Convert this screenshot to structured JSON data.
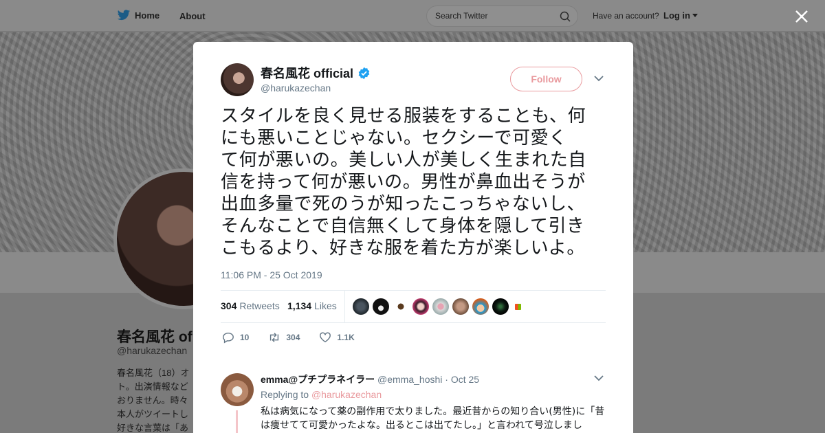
{
  "nav": {
    "home_label": "Home",
    "about_label": "About",
    "search_placeholder": "Search Twitter",
    "account_prompt": "Have an account?",
    "login_label": "Log in"
  },
  "profile": {
    "name": "春名風花 of",
    "handle": "@harukazechan",
    "bio_lines": [
      "春名風花（18）オ",
      "ト。出演情報など",
      "おりません。時々",
      "本人がツイートし",
      "好きな言葉は「あ"
    ]
  },
  "tweet": {
    "author_name": "春名風花 official",
    "author_handle": "@harukazechan",
    "verified": true,
    "follow_label": "Follow",
    "text_lines": [
      "スタイルを良く見せる服装をすることも、何",
      "にも悪いことじゃない。セクシーで可愛く",
      "て何が悪いの。美しい人が美しく生まれた自",
      "信を持って何が悪いの。男性が鼻血出そうが",
      "出血多量で死のうが知ったこっちゃないし、",
      "そんなことで自信無くして身体を隠して引き",
      "こもるより、好きな服を着た方が楽しいよ。"
    ],
    "timestamp": "11:06 PM - 25 Oct 2019",
    "retweets_count": "304",
    "retweets_label": "Retweets",
    "likes_count": "1,134",
    "likes_label": "Likes",
    "actions": {
      "reply_count": "10",
      "retweet_count": "304",
      "like_count": "1.1K"
    }
  },
  "reply": {
    "author_name": "emma@プチプラネイラー",
    "author_handle": "@emma_hoshi",
    "date": "· Oct 25",
    "replying_prefix": "Replying to",
    "replying_to": "@harukazechan",
    "text_lines": [
      "私は病気になって薬の副作用で太りました。最近昔からの知り合い(男性)に「昔",
      "は痩せてて可愛かったよな。出るとこは出てたし。」と言われて号泣しまし"
    ]
  },
  "colors": {
    "accent": "#e99a9e",
    "verified": "#1da1f2",
    "muted": "#657786",
    "text": "#14171a"
  }
}
